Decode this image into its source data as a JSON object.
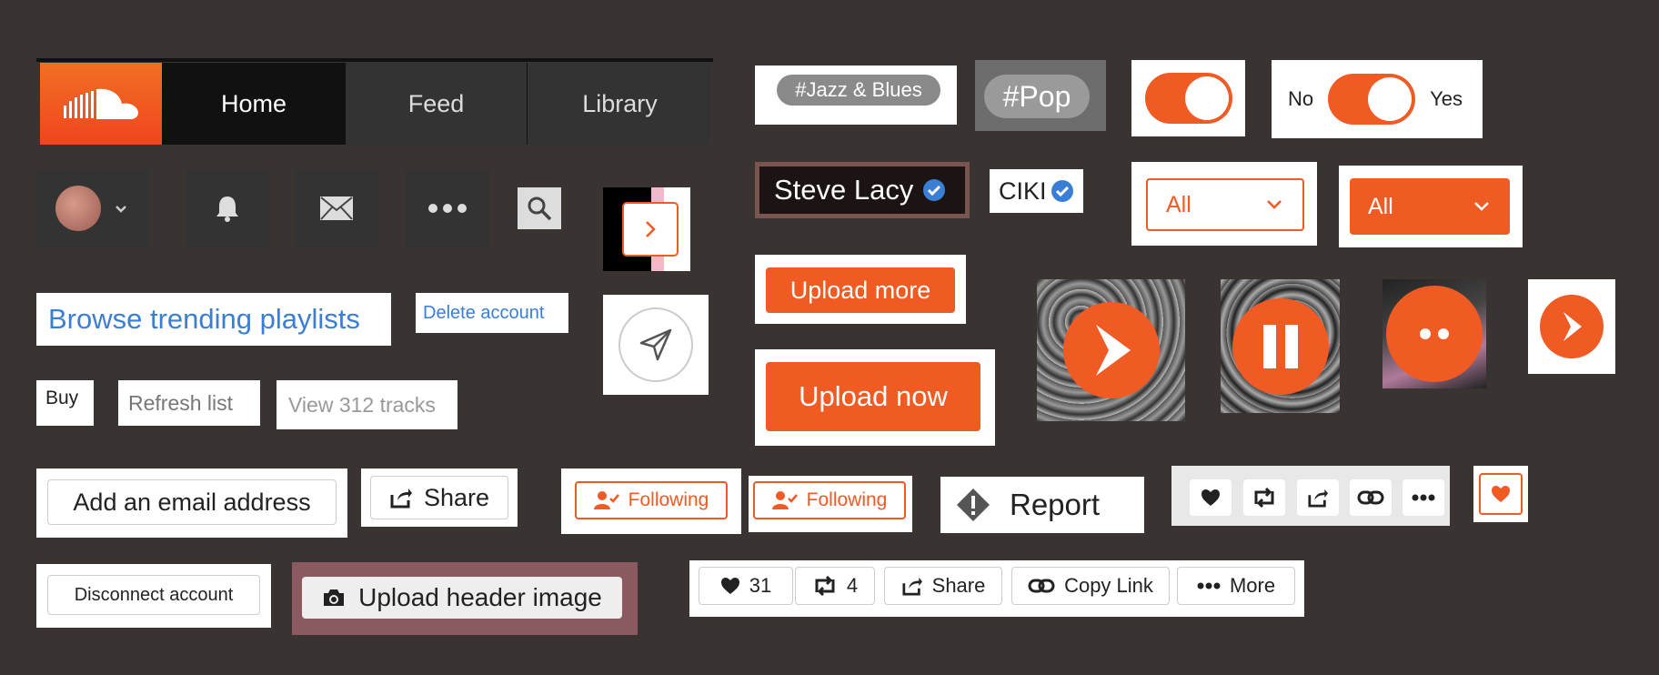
{
  "nav": {
    "logo_icon": "soundcloud-logo-icon",
    "tabs": [
      "Home",
      "Feed",
      "Library"
    ]
  },
  "header_icons": {
    "avatar": "avatar",
    "chevron": "chevron-down-icon",
    "bell": "bell-icon",
    "mail": "mail-icon",
    "more": "more-icon",
    "search": "search-icon"
  },
  "tags": {
    "jazz": "Jazz & Blues",
    "pop": "Pop",
    "hash": "#"
  },
  "toggles": {
    "no": "No",
    "yes": "Yes"
  },
  "artists": {
    "steve": "Steve Lacy",
    "ciki": "CIKI"
  },
  "filters": {
    "outline": "All",
    "filled": "All"
  },
  "links": {
    "browse": "Browse trending playlists",
    "delete": "Delete account"
  },
  "buttons": {
    "buy": "Buy",
    "refresh": "Refresh list",
    "view_tracks": "View 312 tracks",
    "upload_more": "Upload more",
    "upload_now": "Upload now",
    "add_email": "Add an email address",
    "share": "Share",
    "following": "Following",
    "report": "Report",
    "disconnect": "Disconnect account",
    "upload_header": "Upload header image"
  },
  "stats": {
    "likes": "31",
    "reposts": "4",
    "share": "Share",
    "copy_link": "Copy Link",
    "more": "More"
  },
  "colors": {
    "accent": "#f05a23",
    "link": "#3b7fd4",
    "background": "#393431"
  }
}
